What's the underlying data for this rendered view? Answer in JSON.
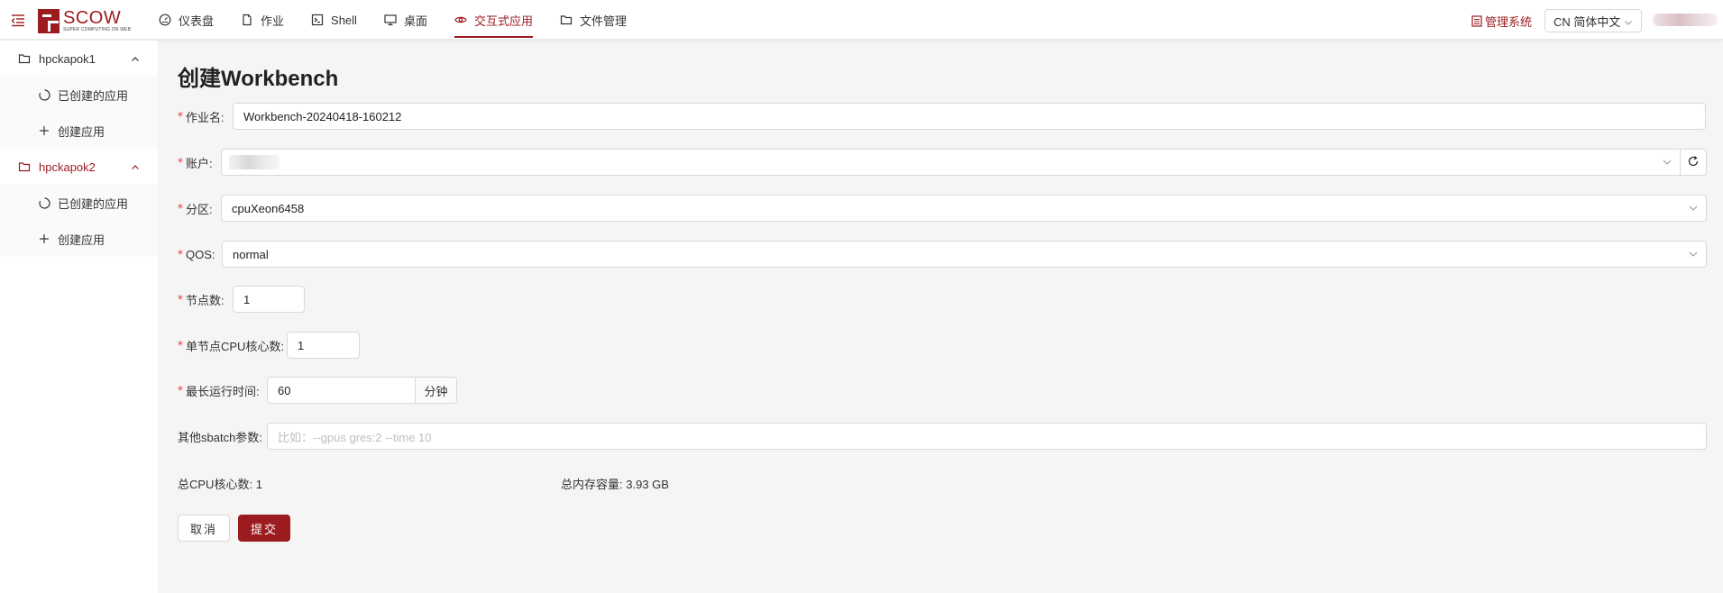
{
  "header": {
    "logo_name": "SCOW",
    "logo_sub": "SUPER COMPUTING ON WEB",
    "nav": [
      {
        "label": "仪表盘",
        "icon": "dashboard-icon"
      },
      {
        "label": "作业",
        "icon": "file-icon"
      },
      {
        "label": "Shell",
        "icon": "terminal-icon"
      },
      {
        "label": "桌面",
        "icon": "desktop-icon"
      },
      {
        "label": "交互式应用",
        "icon": "eye-icon",
        "active": true
      },
      {
        "label": "文件管理",
        "icon": "folder-icon"
      }
    ],
    "admin_label": "管理系统",
    "lang_label": "CN 简体中文"
  },
  "sidebar": {
    "groups": [
      {
        "label": "hpckapok1",
        "items": [
          {
            "label": "已创建的应用",
            "icon": "loading-icon"
          },
          {
            "label": "创建应用",
            "icon": "plus-icon"
          }
        ]
      },
      {
        "label": "hpckapok2",
        "selected": true,
        "items": [
          {
            "label": "已创建的应用",
            "icon": "loading-icon"
          },
          {
            "label": "创建应用",
            "icon": "plus-icon"
          }
        ]
      }
    ]
  },
  "form": {
    "title": "创建Workbench",
    "job_name": {
      "label": "作业名:",
      "value": "Workbench-20240418-160212"
    },
    "account": {
      "label": "账户:",
      "value": ""
    },
    "partition": {
      "label": "分区:",
      "value": "cpuXeon6458"
    },
    "qos": {
      "label": "QOS:",
      "value": "normal"
    },
    "nodes": {
      "label": "节点数:",
      "value": "1"
    },
    "cpu_per_node": {
      "label": "单节点CPU核心数:",
      "value": "1"
    },
    "max_time": {
      "label": "最长运行时间:",
      "value": "60",
      "unit": "分钟"
    },
    "sbatch": {
      "label": "其他sbatch参数:",
      "placeholder": "比如：--gpus gres:2 --time 10"
    },
    "total_cpu_label": "总CPU核心数:",
    "total_cpu_value": "1",
    "total_mem_label": "总内存容量:",
    "total_mem_value": "3.93 GB",
    "cancel_label": "取消",
    "submit_label": "提交"
  },
  "colors": {
    "accent": "#9b1b1f",
    "required": "#e0353b"
  }
}
